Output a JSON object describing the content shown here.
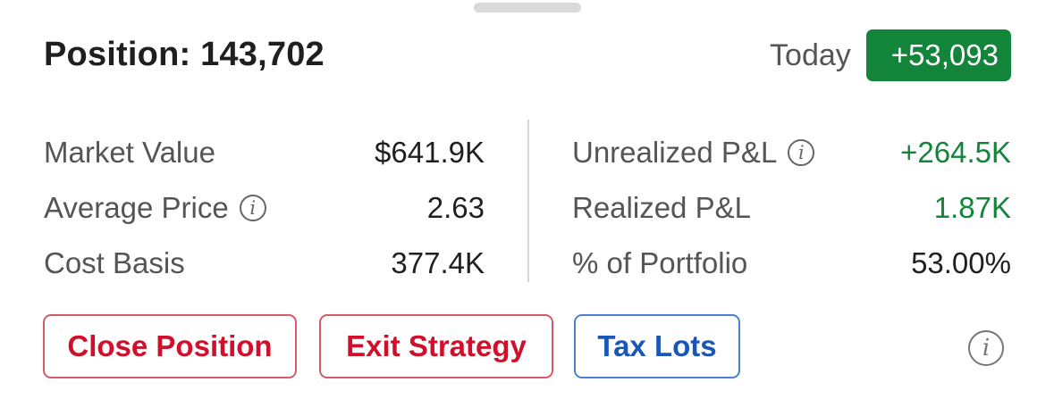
{
  "header": {
    "title": "Position: 143,702",
    "today_label": "Today",
    "today_change": "+53,093"
  },
  "left_stats": [
    {
      "label": "Market Value",
      "value": "$641.9K",
      "info": false
    },
    {
      "label": "Average Price",
      "value": "2.63",
      "info": true
    },
    {
      "label": "Cost Basis",
      "value": "377.4K",
      "info": false
    }
  ],
  "right_stats": [
    {
      "label": "Unrealized P&L",
      "value": "+264.5K",
      "info": true
    },
    {
      "label": "Realized P&L",
      "value": "1.87K",
      "info": false
    },
    {
      "label": "% of Portfolio",
      "value": "53.00%",
      "info": false
    }
  ],
  "actions": {
    "close_position": "Close Position",
    "exit_strategy": "Exit Strategy",
    "tax_lots": "Tax Lots"
  },
  "icons": {
    "info": "info-icon",
    "info_glyph": "i"
  },
  "colors": {
    "positive": "#13853b",
    "danger": "#d0102b",
    "link_blue": "#1a56b8"
  }
}
